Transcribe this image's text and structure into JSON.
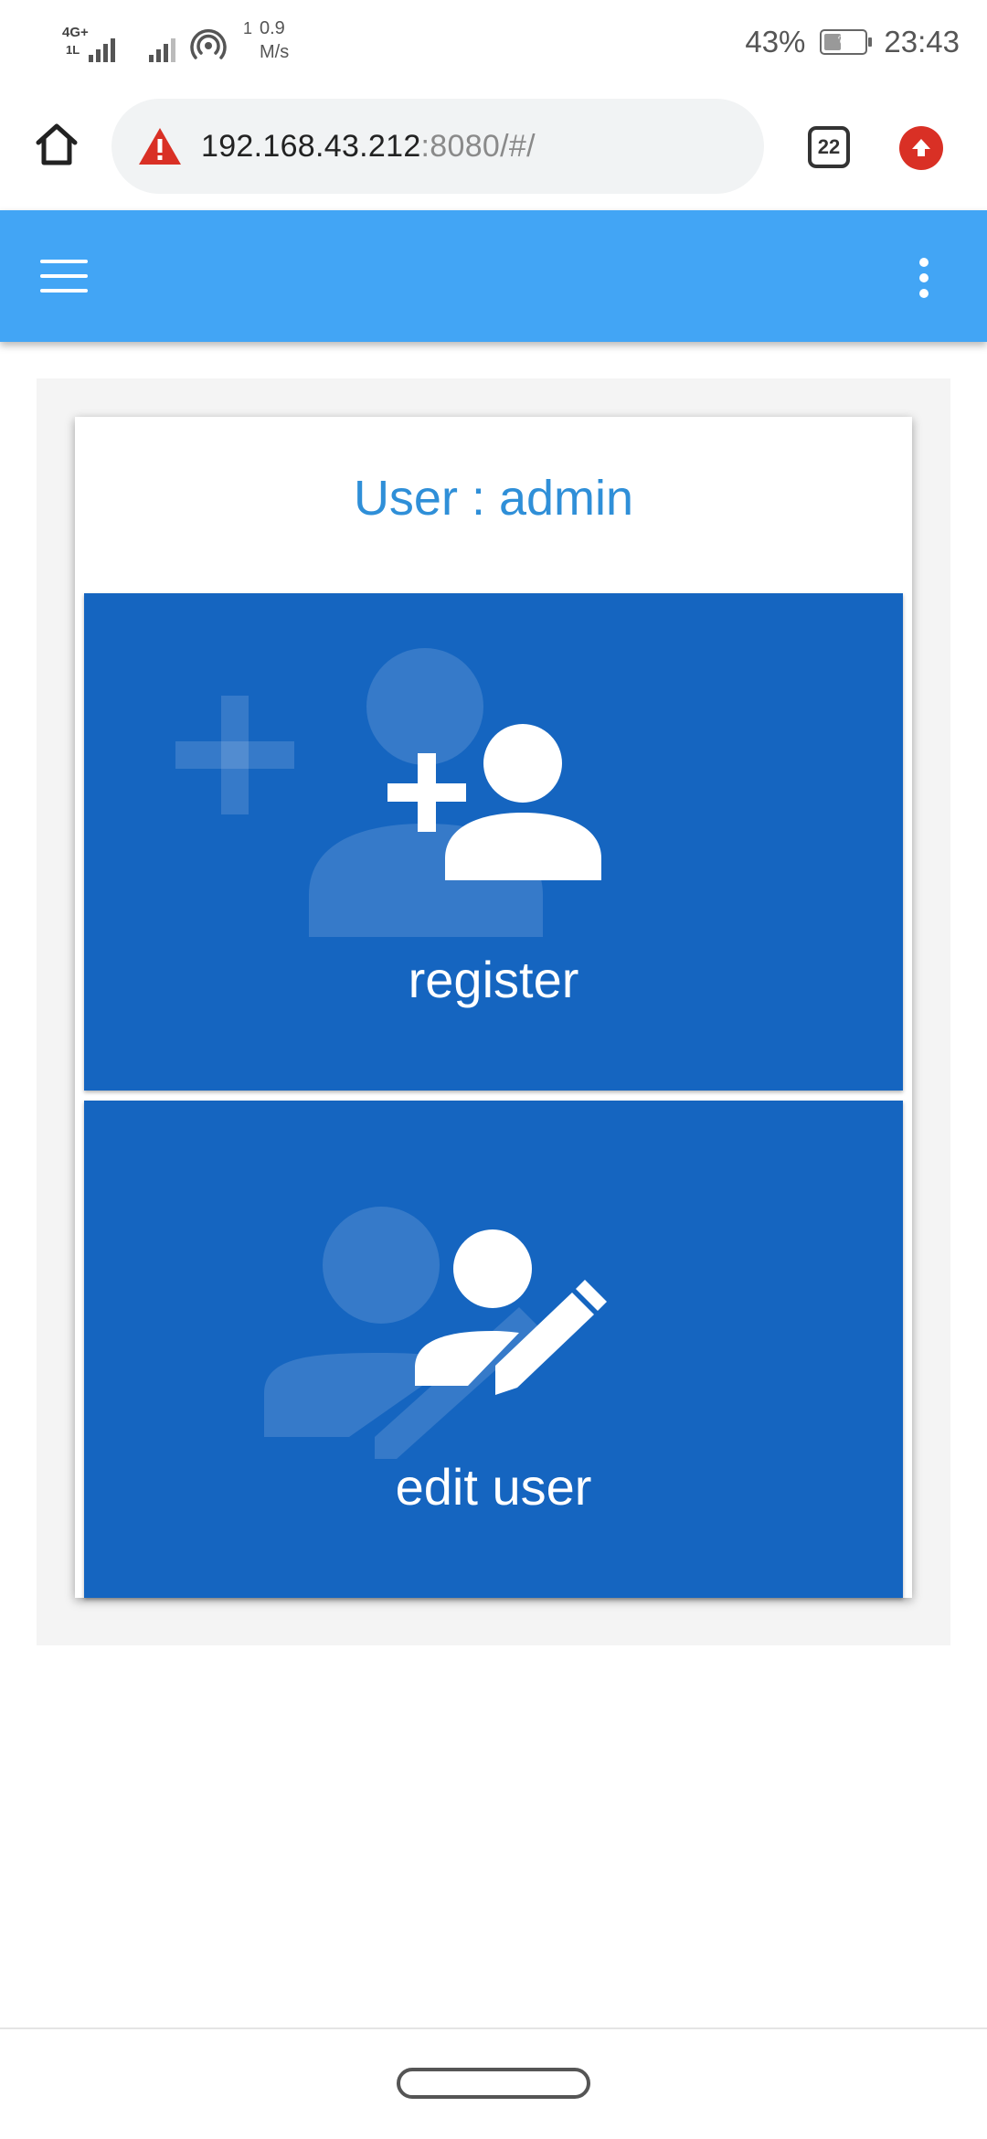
{
  "status_bar": {
    "network_type": "4G+",
    "network_sub": "1L",
    "speed_superscript": "1",
    "speed_value": "0.9",
    "speed_unit": "M/s",
    "battery_percent": "43%",
    "time": "23:43",
    "battery_level_fraction": 0.43,
    "icons": [
      "signal-4g-icon",
      "signal-icon",
      "hotspot-icon",
      "battery-icon"
    ]
  },
  "browser": {
    "url_host": "192.168.43.212",
    "url_rest": ":8080/#/",
    "tab_count": "22",
    "icons": [
      "home-icon",
      "warning-icon",
      "tab-switcher-icon",
      "update-icon"
    ],
    "warning_color": "#d93025"
  },
  "app_bar": {
    "color": "#42a5f5",
    "icons": [
      "menu-icon",
      "more-vert-icon"
    ]
  },
  "card": {
    "title": "User : admin",
    "title_color": "#2f8fd8",
    "tiles": [
      {
        "label": "register",
        "icon": "person-add-icon",
        "color": "#1565c0"
      },
      {
        "label": "edit user",
        "icon": "person-edit-icon",
        "color": "#1565c0"
      }
    ]
  }
}
